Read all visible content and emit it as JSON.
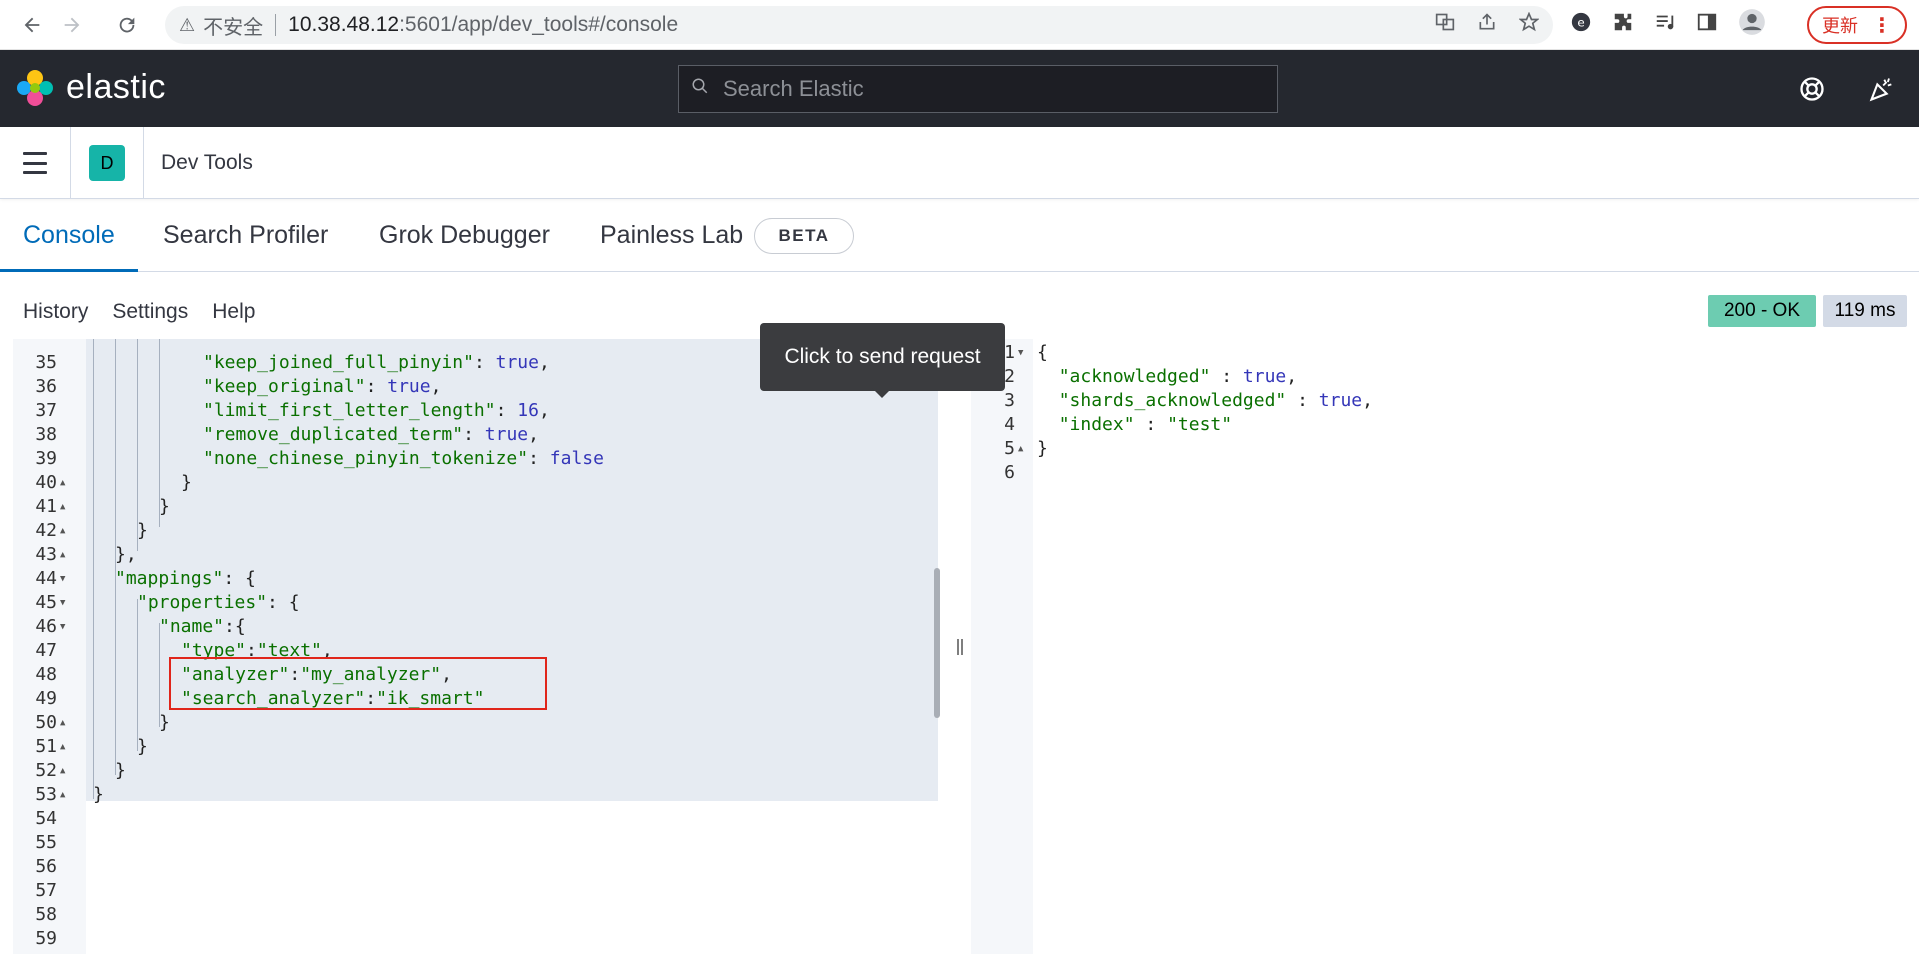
{
  "browser": {
    "insecure_label": "不安全",
    "url_host": "10.38.48.12",
    "url_rest": ":5601/app/dev_tools#/console",
    "update_label": "更新"
  },
  "header": {
    "logo_text": "elastic",
    "search_placeholder": "Search Elastic"
  },
  "appbar": {
    "space_initial": "D",
    "title": "Dev Tools"
  },
  "tabs": [
    {
      "label": "Console"
    },
    {
      "label": "Search Profiler"
    },
    {
      "label": "Grok Debugger"
    },
    {
      "label": "Painless Lab"
    }
  ],
  "beta_label": "BETA",
  "console_menu": {
    "history": "History",
    "settings": "Settings",
    "help": "Help"
  },
  "status": {
    "code": "200 - OK",
    "time": "119 ms"
  },
  "tooltip": "Click to send request",
  "request_lines": [
    {
      "n": "35",
      "fold": "",
      "html": "<span class=\"k\">\"keep_joined_full_pinyin\"</span><span class=\"p\">: </span><span class=\"b\">true</span><span class=\"p\">,</span>"
    },
    {
      "n": "36",
      "fold": "",
      "html": "<span class=\"k\">\"keep_original\"</span><span class=\"p\">: </span><span class=\"b\">true</span><span class=\"p\">,</span>"
    },
    {
      "n": "37",
      "fold": "",
      "html": "<span class=\"k\">\"limit_first_letter_length\"</span><span class=\"p\">: </span><span class=\"n\">16</span><span class=\"p\">,</span>"
    },
    {
      "n": "38",
      "fold": "",
      "html": "<span class=\"k\">\"remove_duplicated_term\"</span><span class=\"p\">: </span><span class=\"b\">true</span><span class=\"p\">,</span>"
    },
    {
      "n": "39",
      "fold": "",
      "html": "<span class=\"k\">\"none_chinese_pinyin_tokenize\"</span><span class=\"p\">: </span><span class=\"b\">false</span>"
    },
    {
      "n": "40",
      "fold": "▲",
      "html": "<span class=\"p\">}</span>"
    },
    {
      "n": "41",
      "fold": "▲",
      "html": "<span class=\"p\">}</span>"
    },
    {
      "n": "42",
      "fold": "▲",
      "html": "<span class=\"p\">}</span>"
    },
    {
      "n": "43",
      "fold": "▲",
      "html": "<span class=\"p\">},</span>"
    },
    {
      "n": "44",
      "fold": "▼",
      "html": "<span class=\"k\">\"mappings\"</span><span class=\"p\">: {</span>"
    },
    {
      "n": "45",
      "fold": "▼",
      "html": "<span class=\"k\">\"properties\"</span><span class=\"p\">: {</span>"
    },
    {
      "n": "46",
      "fold": "▼",
      "html": "<span class=\"k\">\"name\"</span><span class=\"p\">:{</span>"
    },
    {
      "n": "47",
      "fold": "",
      "html": "<span class=\"k\">\"type\"</span><span class=\"p\">:</span><span class=\"s\">\"text\"</span><span class=\"p\">,</span>"
    },
    {
      "n": "48",
      "fold": "",
      "html": "<span class=\"k\">\"analyzer\"</span><span class=\"p\">:</span><span class=\"s\">\"my_analyzer\"</span><span class=\"p\">,</span>"
    },
    {
      "n": "49",
      "fold": "",
      "html": "<span class=\"k\">\"search_analyzer\"</span><span class=\"p\">:</span><span class=\"s\">\"ik_smart\"</span>"
    },
    {
      "n": "50",
      "fold": "▲",
      "html": "<span class=\"p\">}</span>"
    },
    {
      "n": "51",
      "fold": "▲",
      "html": "<span class=\"p\">}</span>"
    },
    {
      "n": "52",
      "fold": "▲",
      "html": "<span class=\"p\">}</span>"
    },
    {
      "n": "53",
      "fold": "▲",
      "html": "<span class=\"p\">}</span>"
    },
    {
      "n": "54",
      "fold": "",
      "html": ""
    },
    {
      "n": "55",
      "fold": "",
      "html": ""
    },
    {
      "n": "56",
      "fold": "",
      "html": ""
    },
    {
      "n": "57",
      "fold": "",
      "html": ""
    },
    {
      "n": "58",
      "fold": "",
      "html": ""
    },
    {
      "n": "59",
      "fold": "",
      "html": ""
    }
  ],
  "response_lines": [
    {
      "n": "1",
      "fold": "▼",
      "html": "<span class=\"p\">{</span>"
    },
    {
      "n": "2",
      "fold": "",
      "html": "  <span class=\"k\">\"acknowledged\"</span><span class=\"p\"> : </span><span class=\"b\">true</span><span class=\"p\">,</span>"
    },
    {
      "n": "3",
      "fold": "",
      "html": "  <span class=\"k\">\"shards_acknowledged\"</span><span class=\"p\"> : </span><span class=\"b\">true</span><span class=\"p\">,</span>"
    },
    {
      "n": "4",
      "fold": "",
      "html": "  <span class=\"k\">\"index\"</span><span class=\"p\"> : </span><span class=\"s\">\"test\"</span>"
    },
    {
      "n": "5",
      "fold": "▲",
      "html": "<span class=\"p\">}</span>"
    },
    {
      "n": "6",
      "fold": "",
      "html": ""
    }
  ]
}
